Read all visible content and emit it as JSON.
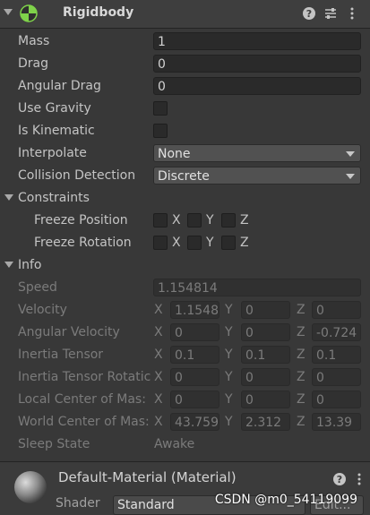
{
  "component": {
    "title": "Rigidbody",
    "icon": "rigidbody-icon"
  },
  "props": {
    "mass": {
      "label": "Mass",
      "value": "1"
    },
    "drag": {
      "label": "Drag",
      "value": "0"
    },
    "angular_drag": {
      "label": "Angular Drag",
      "value": "0"
    },
    "use_gravity": {
      "label": "Use Gravity",
      "checked": false
    },
    "is_kinematic": {
      "label": "Is Kinematic",
      "checked": false
    },
    "interpolate": {
      "label": "Interpolate",
      "value": "None"
    },
    "collision_detection": {
      "label": "Collision Detection",
      "value": "Discrete"
    }
  },
  "constraints": {
    "label": "Constraints",
    "freeze_position": {
      "label": "Freeze Position",
      "x": "X",
      "y": "Y",
      "z": "Z"
    },
    "freeze_rotation": {
      "label": "Freeze Rotation",
      "x": "X",
      "y": "Y",
      "z": "Z"
    }
  },
  "info": {
    "label": "Info",
    "speed": {
      "label": "Speed",
      "value": "1.154814"
    },
    "velocity": {
      "label": "Velocity",
      "x": "1.1548",
      "y": "0",
      "z": "0"
    },
    "angular_velocity": {
      "label": "Angular Velocity",
      "x": "0",
      "y": "0",
      "z": "-0.724"
    },
    "inertia_tensor": {
      "label": "Inertia Tensor",
      "x": "0.1",
      "y": "0.1",
      "z": "0.1"
    },
    "inertia_tensor_rotation": {
      "label": "Inertia Tensor Rotatic",
      "x": "0",
      "y": "0",
      "z": "0"
    },
    "local_center_of_mass": {
      "label": "Local Center of Mas:",
      "x": "0",
      "y": "0",
      "z": "0"
    },
    "world_center_of_mass": {
      "label": "World Center of Mas:",
      "x": "43.759",
      "y": "2.312",
      "z": "13.39"
    },
    "sleep_state": {
      "label": "Sleep State",
      "value": "Awake"
    },
    "axis_x": "X",
    "axis_y": "Y",
    "axis_z": "Z"
  },
  "material": {
    "title": "Default-Material (Material)",
    "shader_label": "Shader",
    "shader_value": "Standard",
    "edit_label": "Edit..."
  },
  "watermark": "CSDN @m0_54119099"
}
